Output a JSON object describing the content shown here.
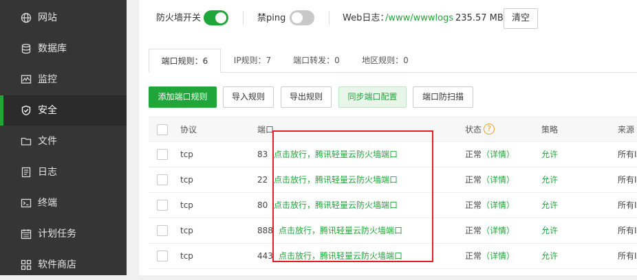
{
  "sidebar": {
    "items": [
      {
        "label": "网站",
        "icon": "globe-icon"
      },
      {
        "label": "数据库",
        "icon": "database-icon"
      },
      {
        "label": "监控",
        "icon": "monitor-icon"
      },
      {
        "label": "安全",
        "icon": "shield-icon",
        "active": true
      },
      {
        "label": "文件",
        "icon": "folder-icon"
      },
      {
        "label": "日志",
        "icon": "log-icon"
      },
      {
        "label": "终端",
        "icon": "terminal-icon"
      },
      {
        "label": "计划任务",
        "icon": "calendar-icon"
      },
      {
        "label": "软件商店",
        "icon": "grid-icon"
      }
    ]
  },
  "topbar": {
    "firewall_label": "防火墙开关",
    "firewall_on": true,
    "ping_label": "禁ping",
    "ping_on": false,
    "weblog_label": "Web日志：",
    "weblog_path": "/www/wwwlogs",
    "weblog_size": "235.57 MB",
    "clear_label": "清空"
  },
  "tabs": [
    {
      "label": "端口规则：6",
      "active": true
    },
    {
      "label": "IP规则：7"
    },
    {
      "label": "端口转发：0"
    },
    {
      "label": "地区规则：0"
    }
  ],
  "actions": {
    "add_label": "添加端口规则",
    "import_label": "导入规则",
    "export_label": "导出规则",
    "sync_label": "同步端口配置",
    "scan_label": "端口防扫描"
  },
  "table": {
    "headers": {
      "protocol": "协议",
      "port": "端口",
      "status": "状态",
      "status_help": "?",
      "policy": "策略",
      "source": "来源"
    },
    "rows": [
      {
        "protocol": "tcp",
        "port": "83",
        "hint": "点击放行，腾讯轻量云防火墙端口",
        "status": "正常",
        "detail": "（详情）",
        "policy": "允许",
        "source": "所有I"
      },
      {
        "protocol": "tcp",
        "port": "22",
        "hint": "点击放行，腾讯轻量云防火墙端口",
        "status": "正常",
        "detail": "（详情）",
        "policy": "允许",
        "source": "所有I"
      },
      {
        "protocol": "tcp",
        "port": "80",
        "hint": "点击放行，腾讯轻量云防火墙端口",
        "status": "正常",
        "detail": "（详情）",
        "policy": "允许",
        "source": "所有I"
      },
      {
        "protocol": "tcp",
        "port": "888",
        "hint": "点击放行，腾讯轻量云防火墙端口",
        "status": "正常",
        "detail": "（详情）",
        "policy": "允许",
        "source": "所有I"
      },
      {
        "protocol": "tcp",
        "port": "443",
        "hint": "点击放行，腾讯轻量云防火墙端口",
        "status": "正常",
        "detail": "（详情）",
        "policy": "允许",
        "source": "所有I"
      }
    ]
  },
  "colors": {
    "accent": "#20a53a",
    "sidebar_bg": "#353535",
    "highlight_box": "#e02020"
  }
}
